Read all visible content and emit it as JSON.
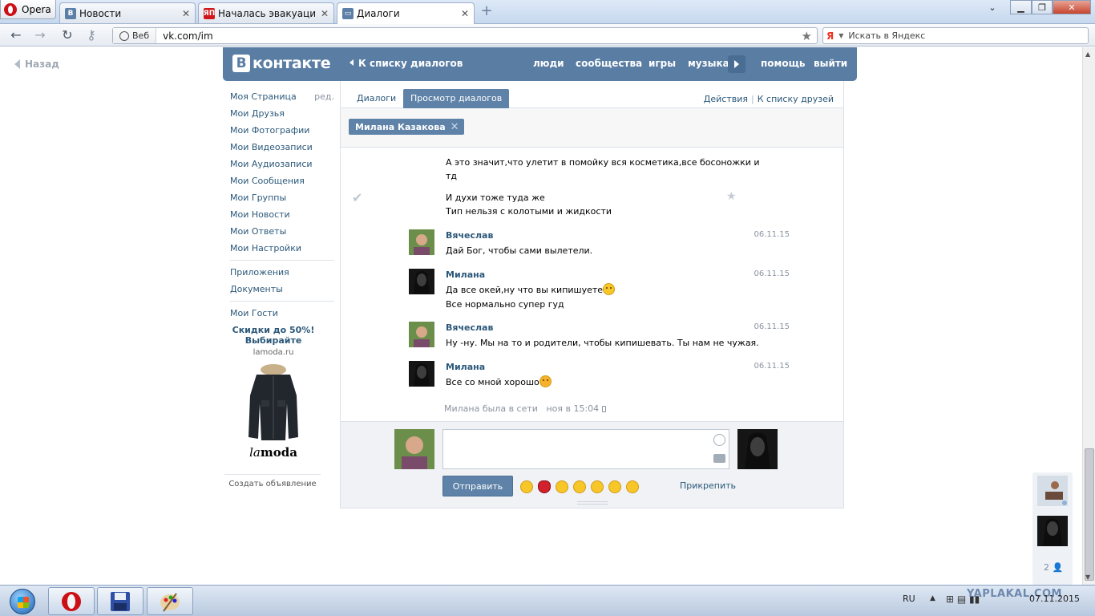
{
  "browser": {
    "menu_label": "Opera",
    "tabs": [
      {
        "label": "Новости",
        "icon": "vk-icon"
      },
      {
        "label": "Началась эвакуация н...",
        "icon": "yaplakal-icon"
      },
      {
        "label": "Диалоги",
        "icon": "vk-messages-icon"
      }
    ],
    "web_badge": "Веб",
    "url": "vk.com/im",
    "search_placeholder": "Искать в Яндекс",
    "search_engine_label": "Я"
  },
  "page": {
    "back_label": "Назад",
    "logo_text": "контакте",
    "logo_letter": "В",
    "back_to_list": "К списку диалогов",
    "nav": [
      "люди",
      "сообщества",
      "игры",
      "музыка",
      "помощь",
      "выйти"
    ]
  },
  "left_menu": {
    "edit_label": "ред.",
    "group1": [
      "Моя Страница",
      "Мои Друзья",
      "Мои Фотографии",
      "Мои Видеозаписи",
      "Мои Аудиозаписи",
      "Мои Сообщения",
      "Мои Группы",
      "Мои Новости",
      "Мои Ответы",
      "Мои Настройки"
    ],
    "group2": [
      "Приложения",
      "Документы"
    ],
    "group3": [
      "Мои Гости"
    ]
  },
  "ad": {
    "title_line1": "Скидки до 50%!",
    "title_line2": "Выбирайте",
    "host": "lamoda.ru",
    "brand_la": "la",
    "brand_moda": "moda",
    "create_label": "Создать объявление"
  },
  "dialog": {
    "tab_dialogs": "Диалоги",
    "tab_view": "Просмотр диалогов",
    "actions": "Действия",
    "friends_list": "К списку друзей",
    "peer_name": "Милана Казакова",
    "prev_lines": [
      "А это значит,что улетит в помойку вся косметика,все босоножки и",
      "тд",
      "И духи тоже туда же",
      "Тип нельзя с колотыми и жидкости"
    ],
    "messages": [
      {
        "name": "Вячеслав",
        "date": "06.11.15",
        "lines": [
          "Дай Бог, чтобы сами вылетели."
        ],
        "emoji": ""
      },
      {
        "name": "Милана",
        "date": "06.11.15",
        "lines": [
          "Да все окей,ну что вы кипишуете",
          "Все нормально супер гуд"
        ],
        "emoji": "confused-emoji"
      },
      {
        "name": "Вячеслав",
        "date": "06.11.15",
        "lines": [
          "Ну -ну. Мы на то и родители, чтобы кипишевать. Ты нам не чужая."
        ],
        "emoji": ""
      },
      {
        "name": "Милана",
        "date": "06.11.15",
        "lines": [
          "Все со мной хорошо"
        ],
        "emoji": "kiss-emoji"
      }
    ],
    "status_text": "Милана была в сети",
    "status_time": "ноя в 15:04",
    "send_label": "Отправить",
    "attach_label": "Прикрепить",
    "online_count": "2"
  },
  "taskbar": {
    "lang": "RU",
    "time": "",
    "date": "07.11.2015",
    "watermark": "YAPLAKAL.COM"
  },
  "colors": {
    "vk_header": "#597da3",
    "vk_link": "#2b587a",
    "vk_button": "#5e82a8"
  }
}
